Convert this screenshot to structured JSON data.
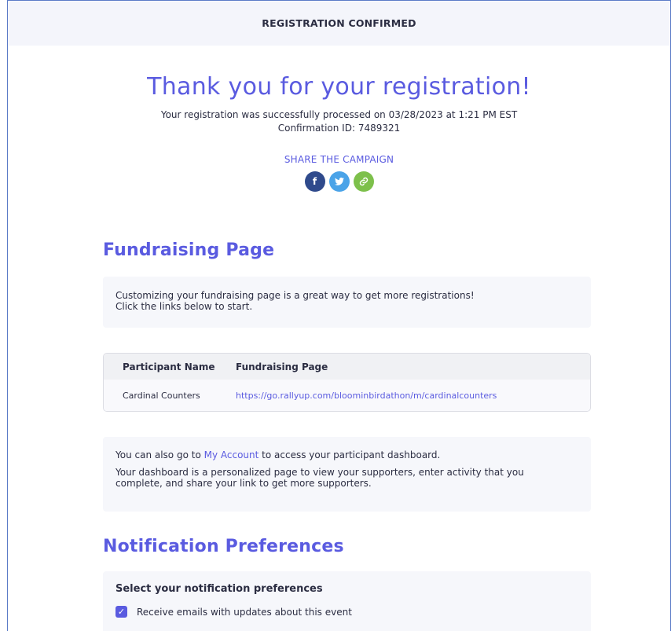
{
  "header": {
    "title": "REGISTRATION CONFIRMED"
  },
  "hero": {
    "heading": "Thank you for your registration!",
    "processed_text": "Your registration was successfully processed on 03/28/2023 at 1:21 PM EST",
    "confirmation_text": "Confirmation ID: 7489321"
  },
  "share": {
    "label": "SHARE THE CAMPAIGN",
    "icons": [
      {
        "name": "facebook-icon",
        "glyph": "f",
        "color": "#2f4a8c"
      },
      {
        "name": "twitter-icon",
        "glyph": "t",
        "color": "#4aa3e8"
      },
      {
        "name": "link-icon",
        "glyph": "⚲",
        "color": "#7dc04b"
      }
    ]
  },
  "fundraising": {
    "title": "Fundraising Page",
    "intro_line1": "Customizing your fundraising page is a great way to get more registrations!",
    "intro_line2": "Click the links below to start.",
    "table": {
      "columns": [
        "Participant Name",
        "Fundraising Page"
      ],
      "rows": [
        {
          "name": "Cardinal Counters",
          "url": "https://go.rallyup.com/bloominbirdathon/m/cardinalcounters"
        }
      ]
    },
    "account_prefix": "You can also go to ",
    "account_link": "My Account",
    "account_suffix": " to access your participant dashboard.",
    "dashboard_line1": "Your dashboard is a personalized page to view your supporters, enter activity that you",
    "dashboard_line2": "complete, and share your link to get more supporters."
  },
  "notifications": {
    "title": "Notification Preferences",
    "subtitle": "Select your notification preferences",
    "options": [
      {
        "label": "Receive emails with updates about this event",
        "checked": true
      }
    ]
  },
  "colors": {
    "accent": "#5a5be0",
    "panel_bg": "#f6f7fb",
    "header_bg": "#f4f5fb"
  }
}
